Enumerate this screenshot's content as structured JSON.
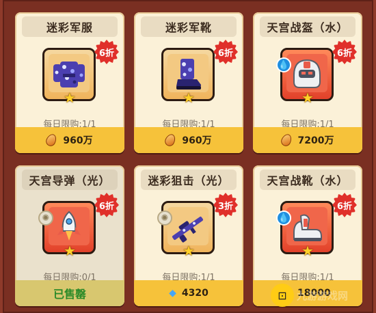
{
  "items": [
    {
      "name": "迷彩军服",
      "discount": "6折",
      "limit": "每日限购:1/1",
      "price": "960万",
      "currency": "coin-icon",
      "element": null,
      "slot": "blue",
      "sold": false
    },
    {
      "name": "迷彩军靴",
      "discount": "6折",
      "limit": "每日限购:1/1",
      "price": "960万",
      "currency": "coin-icon",
      "element": null,
      "slot": "blue",
      "sold": false
    },
    {
      "name": "天宫战盔（水）",
      "discount": "6折",
      "limit": "每日限购:1/1",
      "price": "7200万",
      "currency": "coin-icon",
      "element": "water",
      "slot": "red",
      "sold": false
    },
    {
      "name": "天宫导弹（光）",
      "discount": "6折",
      "limit": "每日限购:0/1",
      "price": "已售罄",
      "currency": null,
      "element": "light",
      "slot": "red",
      "sold": true
    },
    {
      "name": "迷彩狙击（光）",
      "discount": "3折",
      "limit": "每日限购:1/1",
      "price": "4320",
      "currency": "diamond-icon",
      "element": "light",
      "slot": "blue",
      "sold": false
    },
    {
      "name": "天宫战靴（水）",
      "discount": "6折",
      "limit": "每日限购:1/1",
      "price": "18000",
      "currency": "diamond-icon",
      "element": "water",
      "slot": "red",
      "sold": false
    }
  ],
  "watermark": {
    "text": "九游游戏网"
  },
  "colors": {
    "background": "#7a2f22",
    "card": "#fbf1d8",
    "price_bar": "#f6c23a",
    "badge": "#e0302a",
    "sold_text": "#2a8a28"
  }
}
